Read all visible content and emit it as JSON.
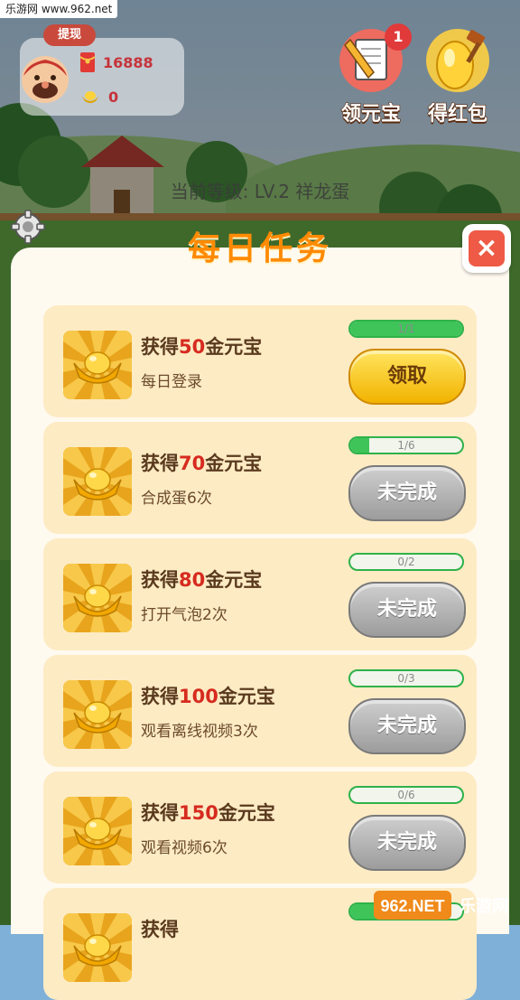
{
  "watermark_top": "乐游网 www.962.net",
  "hud": {
    "withdraw_label": "提现",
    "cash_value": "16888",
    "gold_value": "0"
  },
  "top_buttons": {
    "yuanbao_label": "领元宝",
    "yuanbao_badge": "1",
    "hongbao_label": "得红包"
  },
  "level_text": "当前等级: LV.2 祥龙蛋",
  "modal": {
    "title": "每日任务",
    "close_label": "×",
    "tasks": [
      {
        "prefix": "获得",
        "amount": "50",
        "suffix": "金元宝",
        "desc": "每日登录",
        "progress_text": "1/1",
        "progress": 1.0,
        "button": "领取",
        "state": "claim"
      },
      {
        "prefix": "获得",
        "amount": "70",
        "suffix": "金元宝",
        "desc": "合成蛋6次",
        "progress_text": "1/6",
        "progress": 0.1667,
        "button": "未完成",
        "state": "todo"
      },
      {
        "prefix": "获得",
        "amount": "80",
        "suffix": "金元宝",
        "desc": "打开气泡2次",
        "progress_text": "0/2",
        "progress": 0,
        "button": "未完成",
        "state": "todo"
      },
      {
        "prefix": "获得",
        "amount": "100",
        "suffix": "金元宝",
        "desc": "观看离线视频3次",
        "progress_text": "0/3",
        "progress": 0,
        "button": "未完成",
        "state": "todo"
      },
      {
        "prefix": "获得",
        "amount": "150",
        "suffix": "金元宝",
        "desc": "观看视频6次",
        "progress_text": "0/6",
        "progress": 0,
        "button": "未完成",
        "state": "todo"
      },
      {
        "prefix": "获得",
        "amount": "",
        "suffix": "",
        "desc": "",
        "progress_text": "",
        "progress": 0.5,
        "button": "",
        "state": "partial"
      }
    ]
  },
  "watermark_bottom": {
    "brand": "962.NET",
    "site": "乐游网"
  },
  "colors": {
    "title_orange": "#ff8a00",
    "amount_red": "#d62b1f",
    "card_bg": "#fdebc4",
    "progress_green": "#3fc45a",
    "close_red": "#ee5a45"
  },
  "icons": {
    "card_icon": "gold-ingot-icon",
    "settings": "gear-icon",
    "cash": "red-envelope-icon",
    "gold": "gold-ingot-icon"
  }
}
